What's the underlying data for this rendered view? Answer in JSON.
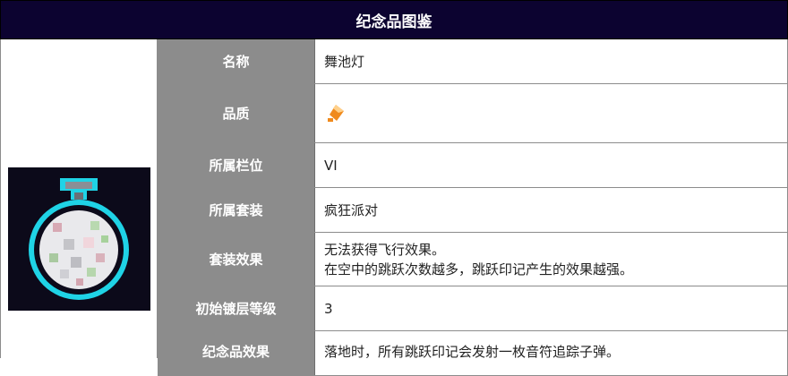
{
  "header": {
    "title": "纪念品图鉴"
  },
  "item": {
    "image_name": "disco-lamp-pixel-icon",
    "colors": {
      "outline": "#1fd3e6",
      "background": "#0c0a1a",
      "accent_quality": "#f08a1c"
    }
  },
  "rows": [
    {
      "label": "名称",
      "value": "舞池灯"
    },
    {
      "label": "品质",
      "value_icon": "orange-quality-gem-icon"
    },
    {
      "label": "所属栏位",
      "value": "VI"
    },
    {
      "label": "所属套装",
      "value": "疯狂派对"
    },
    {
      "label": "套装效果",
      "value_lines": [
        "无法获得飞行效果。",
        "在空中的跳跃次数越多，跳跃印记产生的效果越强。"
      ]
    },
    {
      "label": "初始镀层等级",
      "value": "3"
    },
    {
      "label": "纪念品效果",
      "value": "落地时，所有跳跃印记会发射一枚音符追踪子弹。"
    }
  ]
}
